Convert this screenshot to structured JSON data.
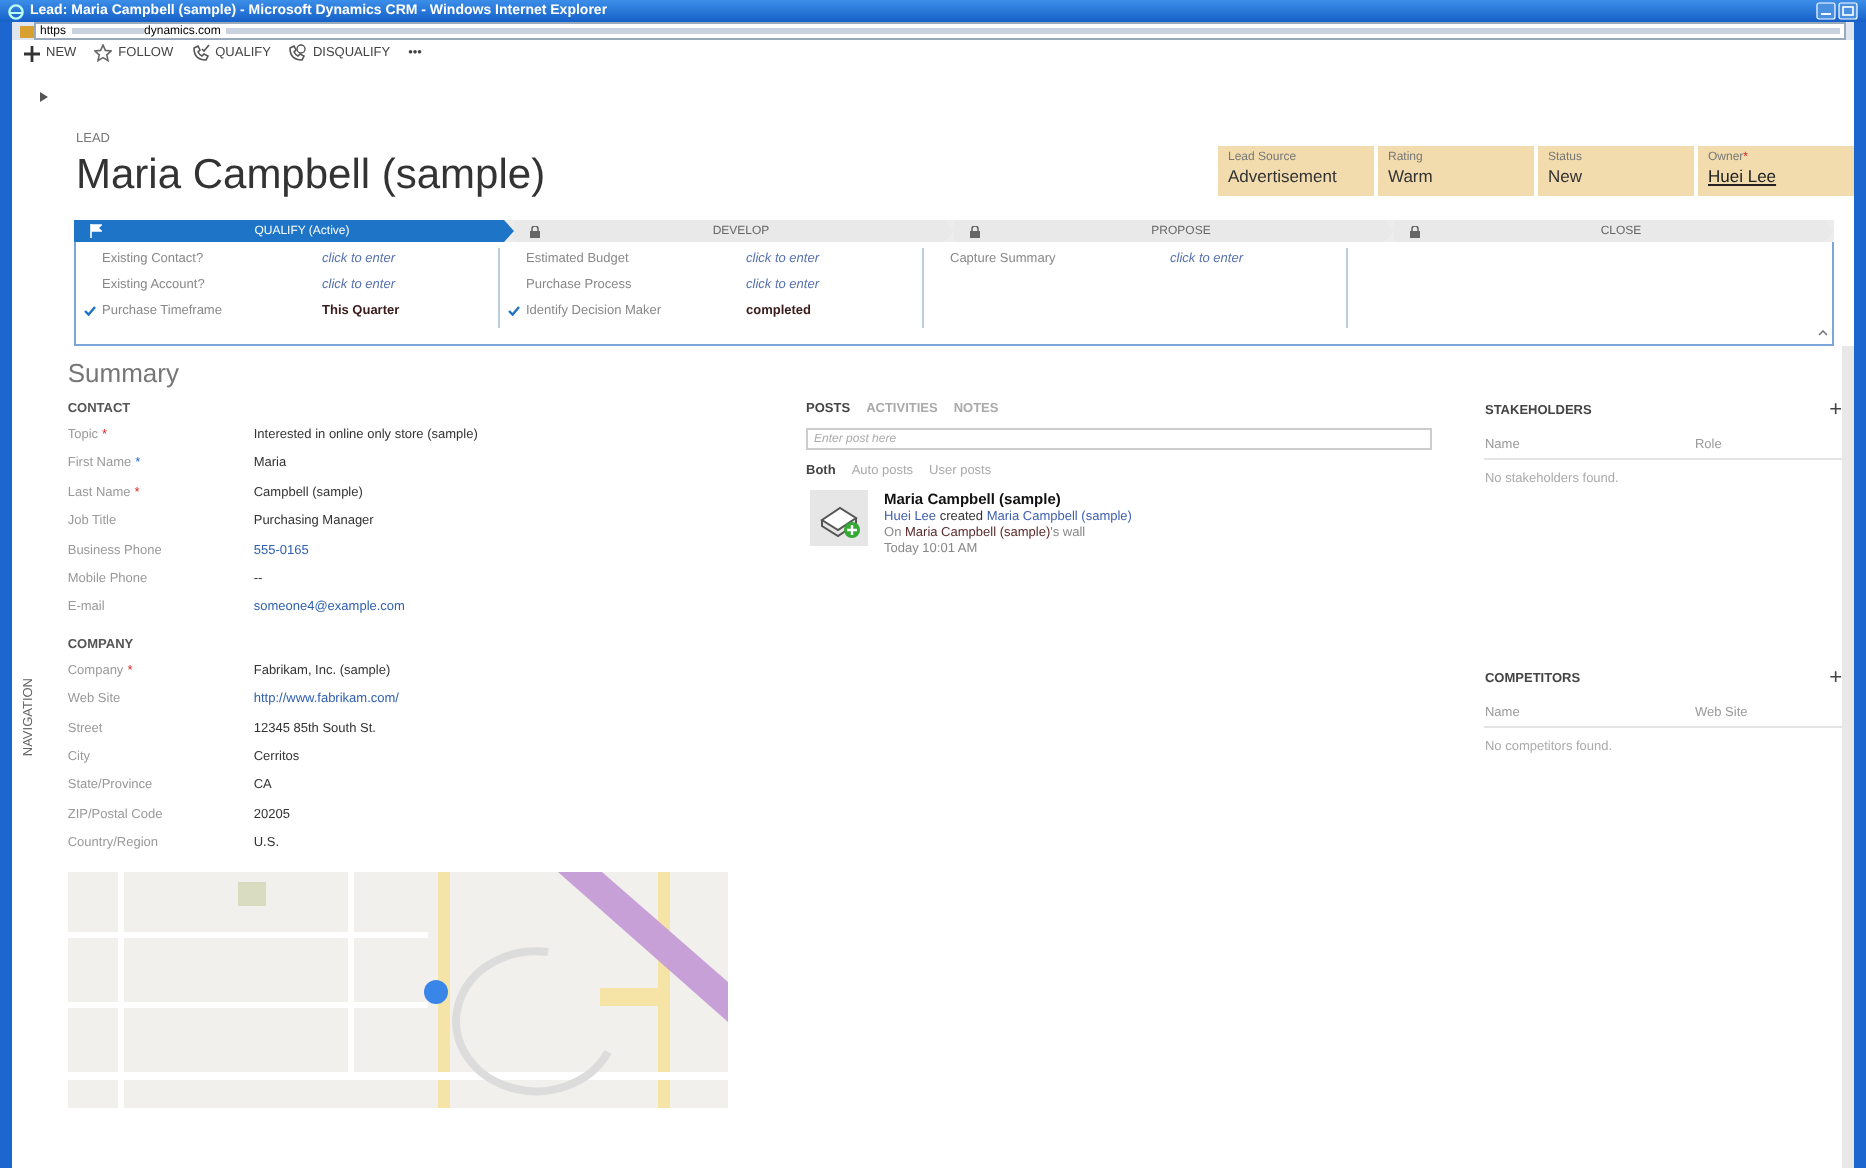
{
  "window": {
    "title": "Lead: Maria Campbell (sample) - Microsoft Dynamics CRM - Windows Internet Explorer"
  },
  "address_bar": {
    "scheme": "https",
    "host": "dynamics.com"
  },
  "command_bar": [
    {
      "label": "NEW",
      "kind": "new"
    },
    {
      "label": "FOLLOW",
      "kind": "follow"
    },
    {
      "label": "QUALIFY",
      "kind": "qualify"
    },
    {
      "label": "DISQUALIFY",
      "kind": "disqualify"
    },
    {
      "label": "•••",
      "kind": "more"
    }
  ],
  "header": {
    "entity": "LEAD",
    "title": "Maria Campbell (sample)",
    "tiles": [
      {
        "label": "Lead Source",
        "value": "Advertisement",
        "link": false
      },
      {
        "label": "Rating",
        "value": "Warm",
        "link": false
      },
      {
        "label": "Status",
        "value": "New",
        "link": false
      },
      {
        "label": "Owner",
        "mark": "*",
        "value": "Huei Lee",
        "link": true
      }
    ]
  },
  "process": {
    "stages": [
      {
        "name": "QUALIFY (Active)",
        "selected": true,
        "locked": false
      },
      {
        "name": "DEVELOP",
        "selected": false,
        "locked": true
      },
      {
        "name": "PROPOSE",
        "selected": false,
        "locked": true
      },
      {
        "name": "CLOSE",
        "selected": false,
        "locked": true
      }
    ],
    "columns": [
      [
        {
          "label": "Existing Contact?",
          "value": "click to enter",
          "kind": "empty",
          "checked": false
        },
        {
          "label": "Existing Account?",
          "value": "click to enter",
          "kind": "empty",
          "checked": false
        },
        {
          "label": "Purchase Timeframe",
          "value": "This Quarter",
          "kind": "value",
          "checked": true
        }
      ],
      [
        {
          "label": "Estimated Budget",
          "value": "click to enter",
          "kind": "empty",
          "checked": false
        },
        {
          "label": "Purchase Process",
          "value": "click to enter",
          "kind": "empty",
          "checked": false
        },
        {
          "label": "Identify Decision Maker",
          "value": "completed",
          "kind": "value",
          "checked": true
        }
      ],
      [
        {
          "label": "Capture Summary",
          "value": "click to enter",
          "kind": "empty",
          "checked": false
        }
      ]
    ]
  },
  "navigation_label": "NAVIGATION",
  "summary": {
    "title": "Summary",
    "sections": [
      {
        "title": "CONTACT",
        "fields": [
          {
            "label": "Topic",
            "mark": {
              "text": "*",
              "kind": "required"
            },
            "value": "Interested in online only store (sample)",
            "link": false
          },
          {
            "label": "First Name",
            "mark": {
              "text": "*",
              "kind": "recommended"
            },
            "value": "Maria",
            "link": false
          },
          {
            "label": "Last Name",
            "mark": {
              "text": "*",
              "kind": "required"
            },
            "value": "Campbell (sample)",
            "link": false
          },
          {
            "label": "Job Title",
            "value": "Purchasing Manager",
            "link": false
          },
          {
            "label": "Business Phone",
            "value": "555-0165",
            "link": true
          },
          {
            "label": "Mobile Phone",
            "value": "--",
            "link": false
          },
          {
            "label": "E-mail",
            "value": "someone4@example.com",
            "link": true
          }
        ]
      },
      {
        "title": "COMPANY",
        "fields": [
          {
            "label": "Company",
            "mark": {
              "text": "*",
              "kind": "required"
            },
            "value": "Fabrikam, Inc. (sample)",
            "link": false
          },
          {
            "label": "Web Site",
            "value": "http://www.fabrikam.com/",
            "link": true
          },
          {
            "label": "Street",
            "value": "12345 85th South St.",
            "link": false
          },
          {
            "label": "City",
            "value": "Cerritos",
            "link": false
          },
          {
            "label": "State/Province",
            "value": "CA",
            "link": false
          },
          {
            "label": "ZIP/Postal Code",
            "value": "20205",
            "link": false
          },
          {
            "label": "Country/Region",
            "value": "U.S.",
            "link": false
          }
        ]
      }
    ]
  },
  "posts": {
    "tabs": [
      {
        "label": "POSTS",
        "selected": true
      },
      {
        "label": "ACTIVITIES",
        "selected": false
      },
      {
        "label": "NOTES",
        "selected": false
      }
    ],
    "input": {
      "placeholder": "Enter post here"
    },
    "filters": [
      {
        "label": "Both",
        "selected": true
      },
      {
        "label": "Auto posts",
        "selected": false
      },
      {
        "label": "User posts",
        "selected": false
      }
    ],
    "items": [
      {
        "title": "Maria Campbell (sample)",
        "lines": [
          [
            {
              "text": "Huei Lee",
              "kind": "link"
            },
            {
              "text": " created ",
              "kind": "plain"
            },
            {
              "text": "Maria Campbell (sample)",
              "kind": "link"
            }
          ],
          [
            {
              "text": "On ",
              "kind": "muted"
            },
            {
              "text": "Maria Campbell (sample)",
              "kind": "entity"
            },
            {
              "text": "'s wall",
              "kind": "muted"
            }
          ]
        ],
        "time": "Today 10:01 AM"
      }
    ]
  },
  "side_panels": [
    {
      "title": "STAKEHOLDERS",
      "add": "+",
      "columns": [
        "Name",
        "Role"
      ],
      "empty": "No stakeholders found."
    },
    {
      "title": "COMPETITORS",
      "add": "+",
      "columns": [
        "Name",
        "Web Site"
      ],
      "empty": "No competitors found."
    }
  ]
}
